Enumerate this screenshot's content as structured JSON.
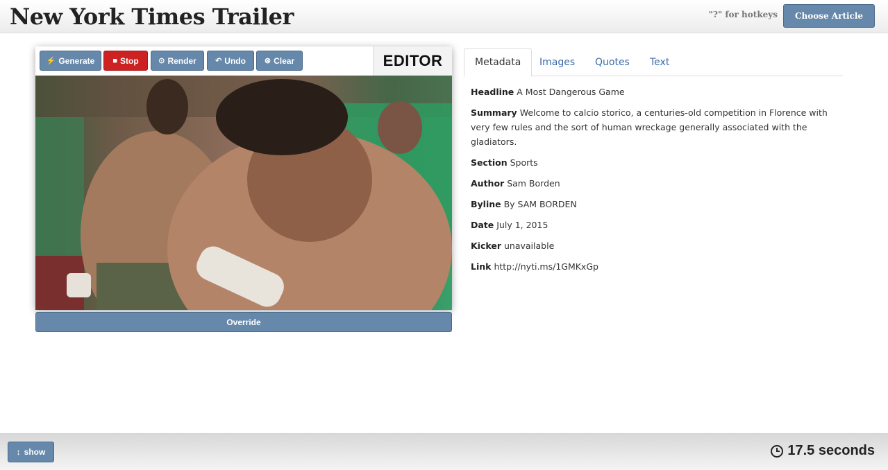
{
  "header": {
    "title": "New York Times Trailer",
    "hotkeys_hint": "\"?\" for hotkeys",
    "choose_article_label": "Choose Article"
  },
  "editor": {
    "label": "EDITOR",
    "toolbar": {
      "generate": {
        "icon": "bolt-icon",
        "label": "Generate"
      },
      "stop": {
        "icon": "stop-icon",
        "label": "Stop"
      },
      "render": {
        "icon": "record-icon",
        "label": "Render"
      },
      "undo": {
        "icon": "undo-icon",
        "label": "Undo"
      },
      "clear": {
        "icon": "clear-icon",
        "label": "Clear"
      }
    },
    "override_label": "Override"
  },
  "tabs": [
    {
      "label": "Metadata",
      "active": true
    },
    {
      "label": "Images",
      "active": false
    },
    {
      "label": "Quotes",
      "active": false
    },
    {
      "label": "Text",
      "active": false
    }
  ],
  "metadata": {
    "headline": {
      "key": "Headline",
      "value": "A Most Dangerous Game"
    },
    "summary": {
      "key": "Summary",
      "value": "Welcome to calcio storico, a centuries-old competition in Florence with very few rules and the sort of human wreckage generally associated with the gladiators."
    },
    "section": {
      "key": "Section",
      "value": "Sports"
    },
    "author": {
      "key": "Author",
      "value": "Sam Borden"
    },
    "byline": {
      "key": "Byline",
      "value": "By SAM BORDEN"
    },
    "date": {
      "key": "Date",
      "value": "July 1, 2015"
    },
    "kicker": {
      "key": "Kicker",
      "value": "unavailable"
    },
    "link": {
      "key": "Link",
      "value": "http://nyti.ms/1GMKxGp"
    }
  },
  "footer": {
    "show_label": "show",
    "show_icon": "vertical-arrows-icon",
    "timer_icon": "clock-icon",
    "timer_text": "17.5 seconds"
  },
  "colors": {
    "button": "#6688aa",
    "stop": "#cc2222",
    "link": "#3a6aa8"
  }
}
